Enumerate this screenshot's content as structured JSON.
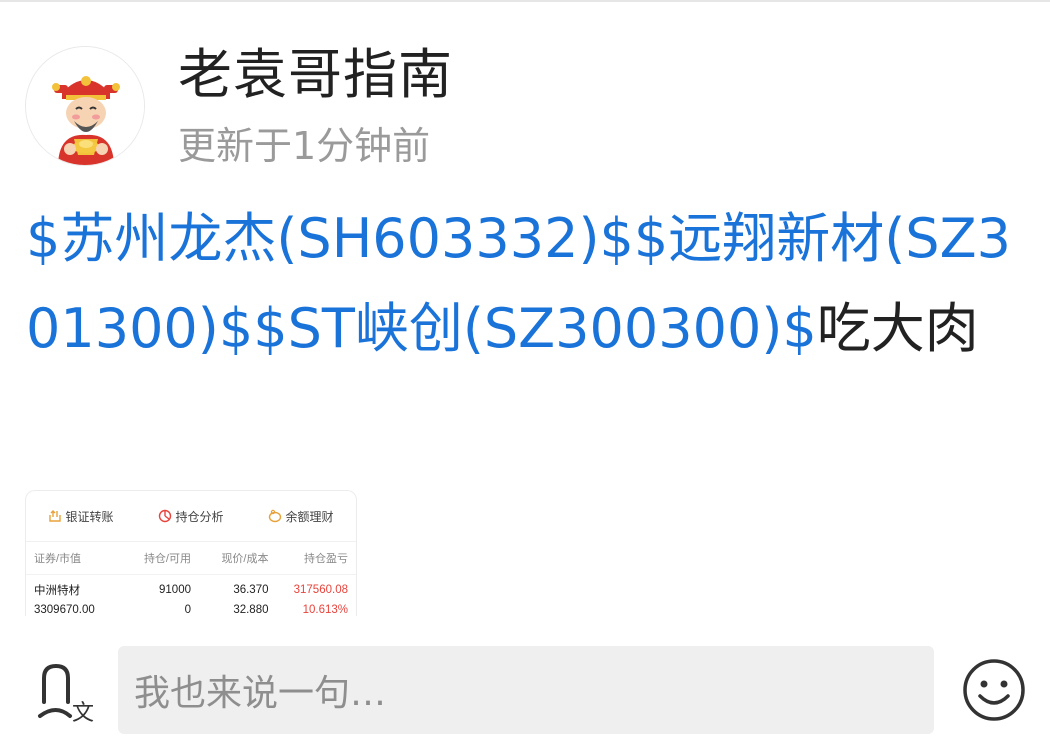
{
  "header": {
    "username": "老袁哥指南",
    "updated": "更新于1分钟前"
  },
  "post": {
    "segments": [
      {
        "text": "$苏州龙杰(SH603332)$",
        "type": "stock-tag"
      },
      {
        "text": "$远翔新材(SZ301300)$",
        "type": "stock-tag"
      },
      {
        "text": "$ST峡创(SZ300300)$",
        "type": "stock-tag"
      },
      {
        "text": "吃大肉",
        "type": "text"
      }
    ]
  },
  "screenshot_card": {
    "nav": [
      {
        "label": "银证转账",
        "icon": "transfer-icon"
      },
      {
        "label": "持仓分析",
        "icon": "pie-chart-icon"
      },
      {
        "label": "余额理财",
        "icon": "piggy-bank-icon"
      }
    ],
    "columns": [
      "证券/市值",
      "持仓/可用",
      "现价/成本",
      "持仓盈亏"
    ],
    "rows": [
      [
        "中洲特材",
        "91000",
        "36.370",
        "317560.08"
      ],
      [
        "3309670.00",
        "0",
        "32.880",
        "10.613%"
      ]
    ],
    "colors": {
      "profit": "#e8443c"
    }
  },
  "comment_bar": {
    "placeholder": "我也来说一句…",
    "voice_icon": "voice-translate-icon",
    "emoji_icon": "smiley-icon"
  },
  "colors": {
    "stock_link": "#1a73d9",
    "text": "#222222",
    "muted": "#9a9a9a"
  }
}
